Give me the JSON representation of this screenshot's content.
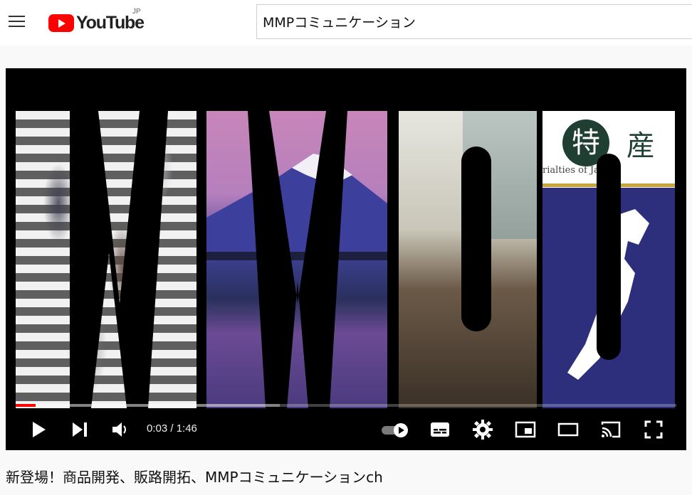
{
  "masthead": {
    "menu_icon": "hamburger-menu-icon",
    "logo_text": "YouTube",
    "logo_region": "JP",
    "search_value": "MMPコミュニケーション"
  },
  "player": {
    "time_current": "0:03",
    "time_separator": " / ",
    "time_total": "1:46",
    "time_display": "0:03 / 1:46",
    "progress_fraction": 0.03,
    "buffered_fraction": 0.4,
    "thumbnail": {
      "kanji_1": "特",
      "kanji_2": "産",
      "subtitle": "rialties of Japan"
    },
    "controls": [
      "play-icon",
      "next-icon",
      "volume-icon",
      "autoplay-toggle-icon",
      "subtitles-icon",
      "settings-icon",
      "miniplayer-icon",
      "theater-icon",
      "cast-icon",
      "fullscreen-icon"
    ],
    "progress_color": "#ff0000"
  },
  "video": {
    "title": "新登場！商品開発、販路開拓、MMPコミュニケーションch"
  },
  "colors": {
    "brand_red": "#ff0000",
    "background": "#f9f9f9"
  }
}
